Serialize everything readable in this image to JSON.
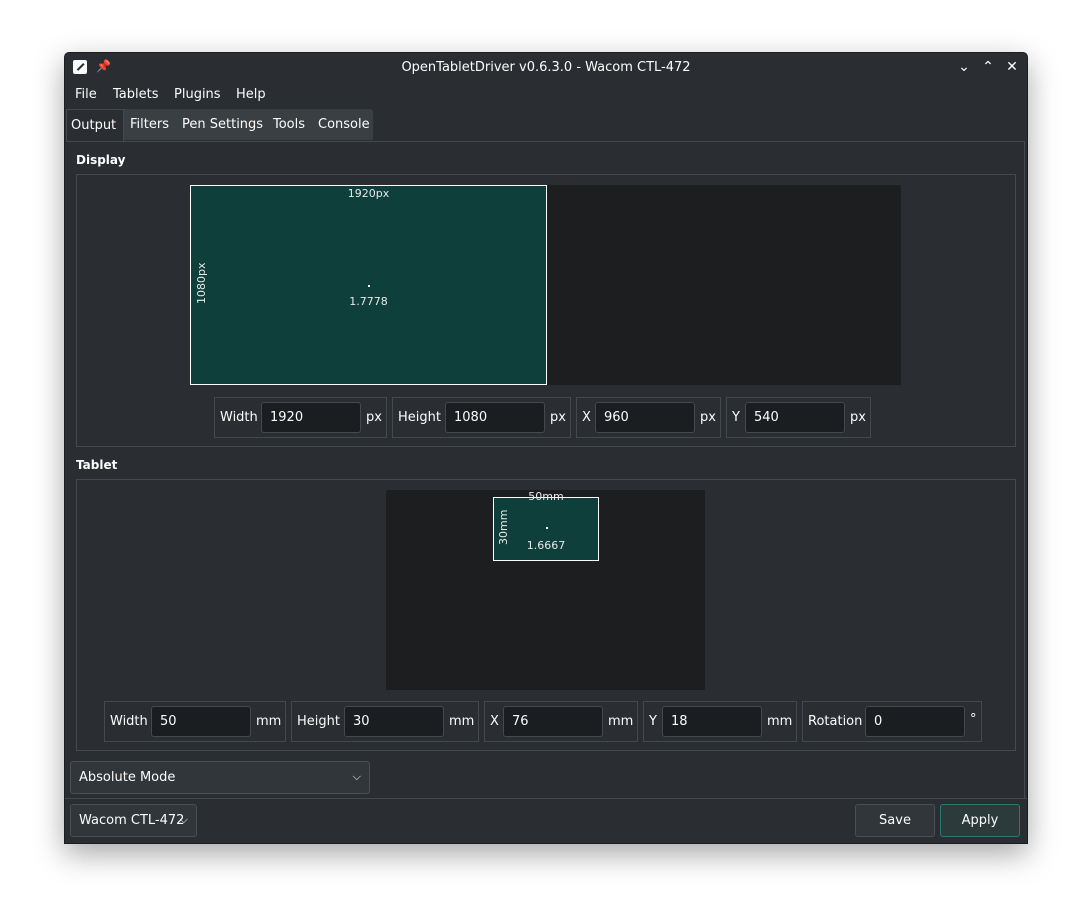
{
  "window": {
    "title": "OpenTabletDriver v0.6.3.0 - Wacom CTL-472"
  },
  "menu": [
    "File",
    "Tablets",
    "Plugins",
    "Help"
  ],
  "tabs": [
    "Output",
    "Filters",
    "Pen Settings",
    "Tools",
    "Console"
  ],
  "display": {
    "section_label": "Display",
    "width_label": "1920px",
    "height_label": "1080px",
    "ratio": "1.7778",
    "fields": {
      "width": {
        "label": "Width",
        "value": "1920",
        "unit": "px"
      },
      "height": {
        "label": "Height",
        "value": "1080",
        "unit": "px"
      },
      "x": {
        "label": "X",
        "value": "960",
        "unit": "px"
      },
      "y": {
        "label": "Y",
        "value": "540",
        "unit": "px"
      }
    }
  },
  "tablet": {
    "section_label": "Tablet",
    "width_label": "50mm",
    "height_label": "30mm",
    "ratio": "1.6667",
    "fields": {
      "width": {
        "label": "Width",
        "value": "50",
        "unit": "mm"
      },
      "height": {
        "label": "Height",
        "value": "30",
        "unit": "mm"
      },
      "x": {
        "label": "X",
        "value": "76",
        "unit": "mm"
      },
      "y": {
        "label": "Y",
        "value": "18",
        "unit": "mm"
      },
      "rotation": {
        "label": "Rotation",
        "value": "0",
        "unit": "°"
      }
    }
  },
  "mode_select": {
    "value": "Absolute Mode"
  },
  "device_select": {
    "value": "Wacom CTL-472"
  },
  "buttons": {
    "save": "Save",
    "apply": "Apply"
  },
  "colors": {
    "window_bg": "#2a2e32",
    "area_fill": "#0e3f3b",
    "area_bg": "#1d1e20"
  }
}
